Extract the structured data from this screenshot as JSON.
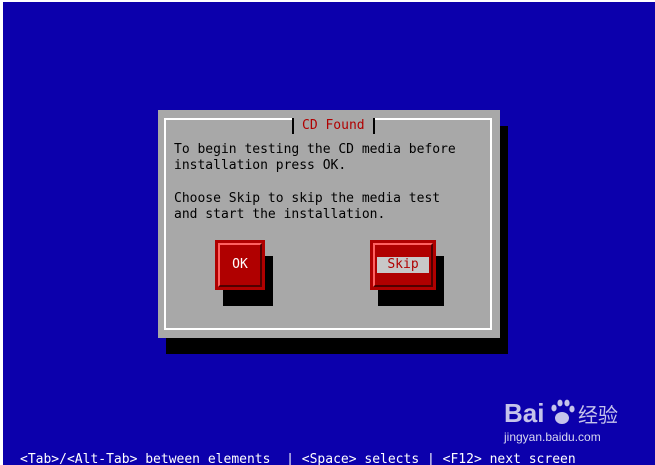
{
  "dialog": {
    "title": "CD Found",
    "message_lines": [
      "To begin testing the CD media before",
      "installation press OK.",
      "",
      "Choose Skip to skip the media test",
      "and start the installation."
    ],
    "buttons": {
      "ok_label": "OK",
      "skip_label": "Skip"
    }
  },
  "status_bar": {
    "text": "<Tab>/<Alt-Tab> between elements  | <Space> selects | <F12> next screen"
  },
  "watermark": {
    "brand": "Bai经验",
    "url": "jingyan.baidu.com"
  },
  "colors": {
    "screen_background": "#0c00ac",
    "dialog_background": "#a8a8a8",
    "title_text": "#b00000",
    "button_background": "#b00000",
    "status_text": "#ffffff"
  }
}
